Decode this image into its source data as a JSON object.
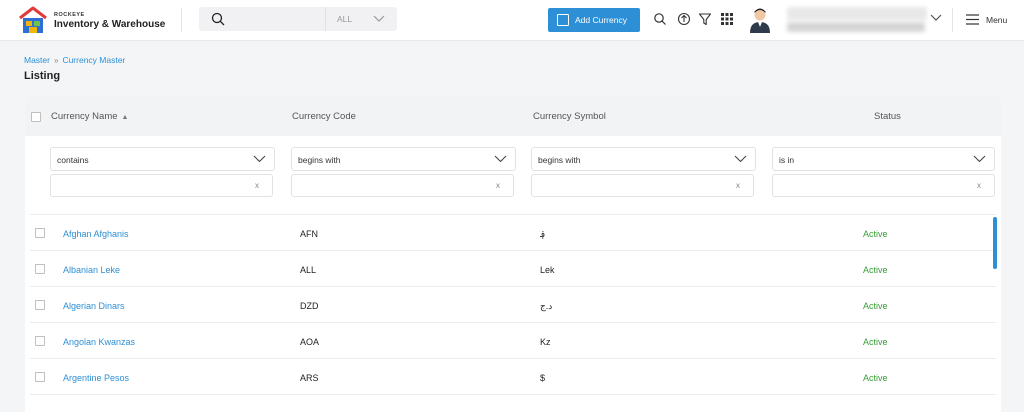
{
  "brand": {
    "small": "ROCKEYE",
    "title": "Inventory & Warehouse"
  },
  "search": {
    "value": "",
    "placeholder": "",
    "scope": "ALL"
  },
  "header": {
    "add_button": "Add Currency",
    "menu_label": "Menu"
  },
  "breadcrumb": {
    "items": [
      "Master",
      "Currency Master"
    ]
  },
  "page": {
    "title": "Listing"
  },
  "table": {
    "columns": [
      "Currency Name",
      "Currency Code",
      "Currency Symbol",
      "Status"
    ],
    "filters": [
      {
        "operator": "contains",
        "value": "",
        "clear": "x"
      },
      {
        "operator": "begins with",
        "value": "",
        "clear": "x"
      },
      {
        "operator": "begins with",
        "value": "",
        "clear": "x"
      },
      {
        "operator": "is in",
        "value": "",
        "clear": "x"
      }
    ],
    "rows": [
      {
        "name": "Afghan Afghanis",
        "code": "AFN",
        "symbol": "؋",
        "status": "Active"
      },
      {
        "name": "Albanian Leke",
        "code": "ALL",
        "symbol": "Lek",
        "status": "Active"
      },
      {
        "name": "Algerian Dinars",
        "code": "DZD",
        "symbol": "د.ج",
        "status": "Active"
      },
      {
        "name": "Angolan Kwanzas",
        "code": "AOA",
        "symbol": "Kz",
        "status": "Active"
      },
      {
        "name": "Argentine Pesos",
        "code": "ARS",
        "symbol": "$",
        "status": "Active"
      }
    ]
  },
  "colors": {
    "accent": "#2d8fd5",
    "active": "#3a9d3a"
  },
  "icons": [
    "home-logo-icon",
    "search-icon",
    "chevron-down-icon",
    "plus-icon",
    "upload-icon",
    "filter-icon",
    "grid-icon",
    "menu-icon"
  ]
}
